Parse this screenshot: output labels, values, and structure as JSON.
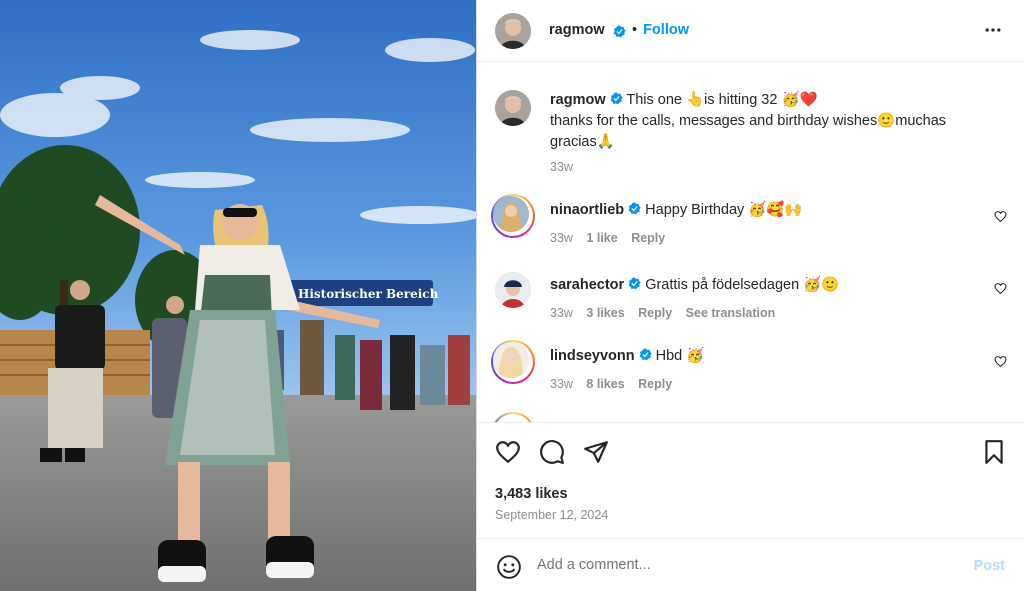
{
  "post": {
    "author": "ragmow",
    "follow_label": "Follow",
    "dot": "•",
    "caption": {
      "username": "ragmow",
      "line1": "This one 👆is hitting 32 🥳❤️",
      "line2": "thanks for the calls, messages and birthday wishes🙂muchas gracias🙏",
      "time": "33w"
    },
    "comments": [
      {
        "username": "nina­ortlieb",
        "text": "Happy Birthday 🥳🥰🙌",
        "time": "33w",
        "likes": "1 like",
        "reply": "Reply",
        "translate": ""
      },
      {
        "username": "sarahector",
        "text": "Grattis på födelsedagen 🥳🙂",
        "time": "33w",
        "likes": "3 likes",
        "reply": "Reply",
        "translate": "See translation"
      },
      {
        "username": "lindseyvonn",
        "text": "Hbd 🥳",
        "time": "33w",
        "likes": "8 likes",
        "reply": "Reply",
        "translate": ""
      }
    ],
    "likes_count": "3,483 likes",
    "date": "September 12, 2024",
    "add_comment_placeholder": "Add a comment...",
    "post_label": "Post",
    "photo_banner_text": "Historischer Bereich"
  },
  "icons": {
    "more": "more-horizontal-icon",
    "heart": "heart-icon",
    "comment": "comment-icon",
    "share": "share-icon",
    "save": "bookmark-icon",
    "emoji": "emoji-icon",
    "verified": "verified-badge-icon"
  },
  "colors": {
    "accent": "#0095f6",
    "post_disabled": "#b3dbff",
    "muted": "#8e8e8e"
  }
}
